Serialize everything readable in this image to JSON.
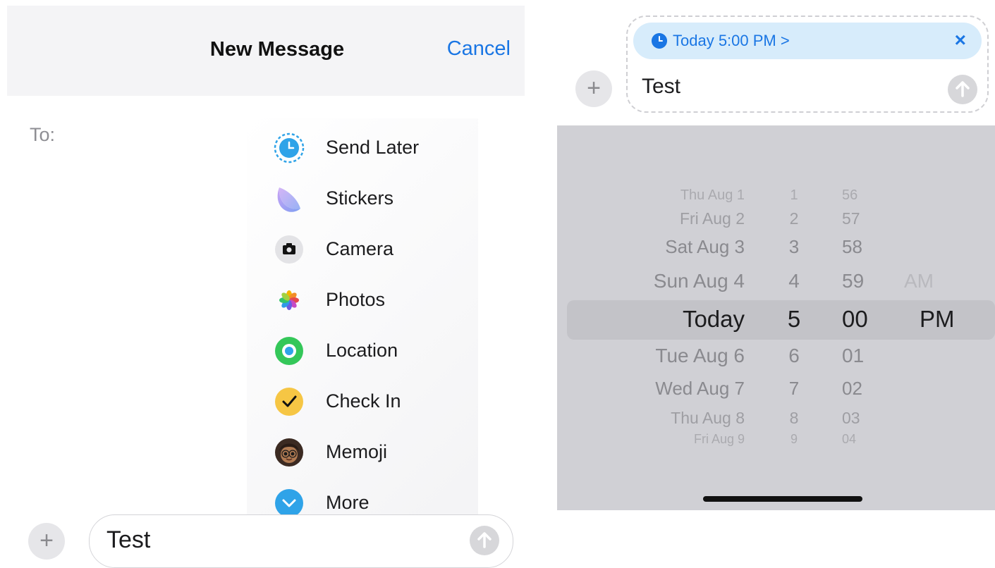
{
  "left": {
    "header": {
      "title": "New Message",
      "cancel": "Cancel"
    },
    "to_label": "To:",
    "menu_items": [
      {
        "label": "Send Later",
        "icon": "clock-icon"
      },
      {
        "label": "Stickers",
        "icon": "stickers-icon"
      },
      {
        "label": "Camera",
        "icon": "camera-icon"
      },
      {
        "label": "Photos",
        "icon": "photos-icon"
      },
      {
        "label": "Location",
        "icon": "location-icon"
      },
      {
        "label": "Check In",
        "icon": "checkmark-icon"
      },
      {
        "label": "Memoji",
        "icon": "memoji-icon"
      },
      {
        "label": "More",
        "icon": "chevron-down-icon"
      }
    ],
    "input_value": "Test"
  },
  "right": {
    "schedule_label": "Today 5:00 PM >",
    "close_glyph": "×",
    "input_value": "Test",
    "picker": {
      "rows": [
        {
          "day": "Thu Aug 1",
          "hour": "1",
          "minute": "56",
          "period": ""
        },
        {
          "day": "Fri Aug 2",
          "hour": "2",
          "minute": "57",
          "period": ""
        },
        {
          "day": "Sat Aug 3",
          "hour": "3",
          "minute": "58",
          "period": ""
        },
        {
          "day": "Sun Aug 4",
          "hour": "4",
          "minute": "59",
          "period": "AM"
        },
        {
          "day": "Today",
          "hour": "5",
          "minute": "00",
          "period": "PM"
        },
        {
          "day": "Tue Aug 6",
          "hour": "6",
          "minute": "01",
          "period": ""
        },
        {
          "day": "Wed Aug 7",
          "hour": "7",
          "minute": "02",
          "period": ""
        },
        {
          "day": "Thu Aug 8",
          "hour": "8",
          "minute": "03",
          "period": ""
        },
        {
          "day": "Fri Aug 9",
          "hour": "9",
          "minute": "04",
          "period": ""
        }
      ],
      "selected_index": 4
    }
  },
  "colors": {
    "accent": "#1a76e4",
    "header_bg": "#f4f4f6",
    "picker_bg": "#d0d0d5",
    "pill_bg": "#d7ecfb"
  }
}
